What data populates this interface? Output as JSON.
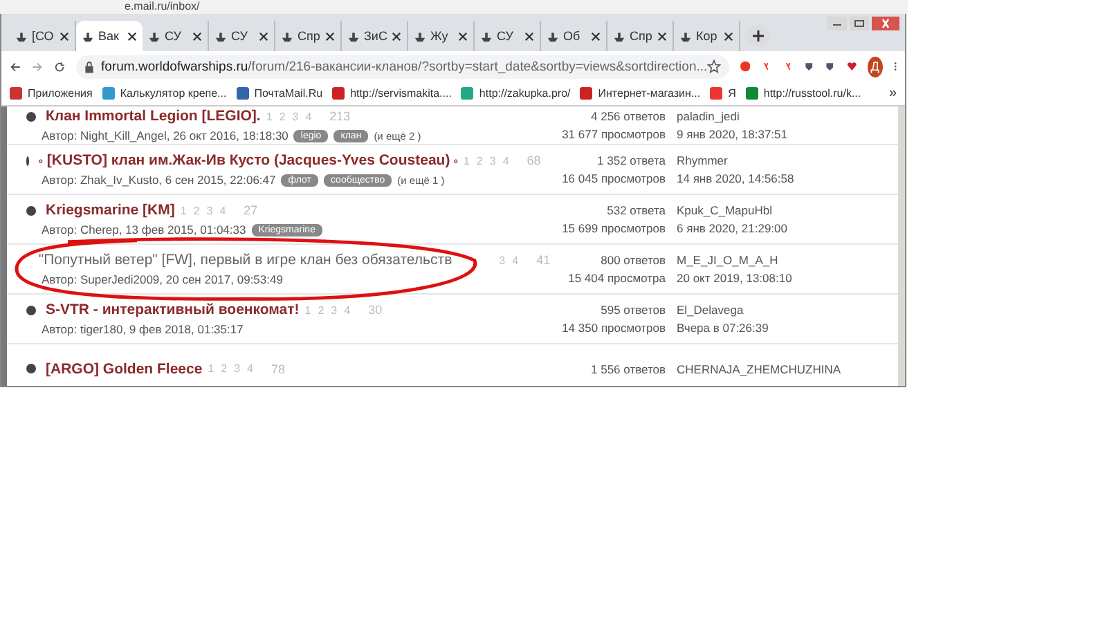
{
  "back_window": {
    "url": "e.mail.ru/inbox/"
  },
  "tabs": [
    {
      "label": "[СО",
      "selected": false
    },
    {
      "label": "Вак",
      "selected": true
    },
    {
      "label": "СУ",
      "selected": false
    },
    {
      "label": "СУ",
      "selected": false
    },
    {
      "label": "Спр",
      "selected": false
    },
    {
      "label": "ЗиС",
      "selected": false
    },
    {
      "label": "Жу",
      "selected": false
    },
    {
      "label": "СУ",
      "selected": false
    },
    {
      "label": "Об",
      "selected": false
    },
    {
      "label": "Спр",
      "selected": false
    },
    {
      "label": "Кор",
      "selected": false
    }
  ],
  "address_bar": {
    "host": "forum.worldofwarships.ru",
    "path": "/forum/216-вакансии-кланов/?sortby=start_date&sortby=views&sortdirection..."
  },
  "profile": {
    "initial": "Д"
  },
  "bookmarks": [
    {
      "label": "Приложения"
    },
    {
      "label": "Калькулятор крепе..."
    },
    {
      "label": "ПочтаMail.Ru"
    },
    {
      "label": "http://servismakita...."
    },
    {
      "label": "http://zakupka.pro/"
    },
    {
      "label": "Интернет-магазин..."
    },
    {
      "label": "Я"
    },
    {
      "label": "http://russtool.ru/k..."
    }
  ],
  "bookmarks_more": "»",
  "topics": [
    {
      "title": "Клан Immortal Legion [LEGIO].",
      "unread": true,
      "circled": false,
      "badged": false,
      "pages": [
        "1",
        "2",
        "3",
        "4",
        "213"
      ],
      "author": "Автор: Night_Kill_Angel, 26 окт 2016, 18:18:30",
      "tags": [
        "legio",
        "клан"
      ],
      "more_tags": "(и ещё 2 )",
      "replies": "4 256 ответов",
      "views": "31 677 просмотров",
      "last_user": "paladin_jedi",
      "last_date": "9 янв 2020, 18:37:51"
    },
    {
      "title": "[KUSTO] клан им.Жак-Ив Кусто (Jacques-Yves Cousteau)",
      "unread": true,
      "circled": false,
      "badged": true,
      "pages": [
        "1",
        "2",
        "3",
        "4",
        "68"
      ],
      "author": "Автор: Zhak_Iv_Kusto, 6 сен 2015, 22:06:47",
      "tags": [
        "флот",
        "сообщество"
      ],
      "more_tags": "(и ещё 1 )",
      "replies": "1 352 ответа",
      "views": "16 045 просмотров",
      "last_user": "Rhymmer",
      "last_date": "14 янв 2020, 14:56:58"
    },
    {
      "title": "Kriegsmarine [KM]",
      "unread": true,
      "circled": false,
      "badged": false,
      "pages": [
        "1",
        "2",
        "3",
        "4",
        "27"
      ],
      "author": "Автор: Cherep, 13 фев 2015, 01:04:33",
      "tags": [
        "Kriegsmarine"
      ],
      "replies": "532 ответа",
      "views": "15 699 просмотров",
      "last_user": "Kpuk_C_MapuHbl",
      "last_date": "6 янв 2020, 21:29:00"
    },
    {
      "title": "\"Попутный ветер\" [FW], первый в игре клан без обязательств",
      "unread": false,
      "circled": true,
      "badged": false,
      "pages": [
        "3",
        "4",
        "41"
      ],
      "author": "Автор: SuperJedi2009, 20 сен 2017, 09:53:49",
      "replies": "800 ответов",
      "views": "15 404 просмотра",
      "last_user": "M_E_JI_O_M_A_H",
      "last_date": "20 окт 2019, 13:08:10"
    },
    {
      "title": "S-VTR - интерактивный военкомат!",
      "unread": true,
      "circled": false,
      "badged": false,
      "pages": [
        "1",
        "2",
        "3",
        "4",
        "30"
      ],
      "author": "Автор: tiger180, 9 фев 2018, 01:35:17",
      "replies": "595 ответов",
      "views": "14 350 просмотров",
      "last_user": "El_Delavega",
      "last_date": "Вчера в 07:26:39"
    },
    {
      "title": "[ARGO] Golden Fleece",
      "unread": true,
      "circled": false,
      "badged": false,
      "pages": [
        "1",
        "2",
        "3",
        "4",
        "78"
      ],
      "replies": "1 556 ответов",
      "last_user": "CHERNAJA_ZHEMCHUZHINA"
    }
  ]
}
